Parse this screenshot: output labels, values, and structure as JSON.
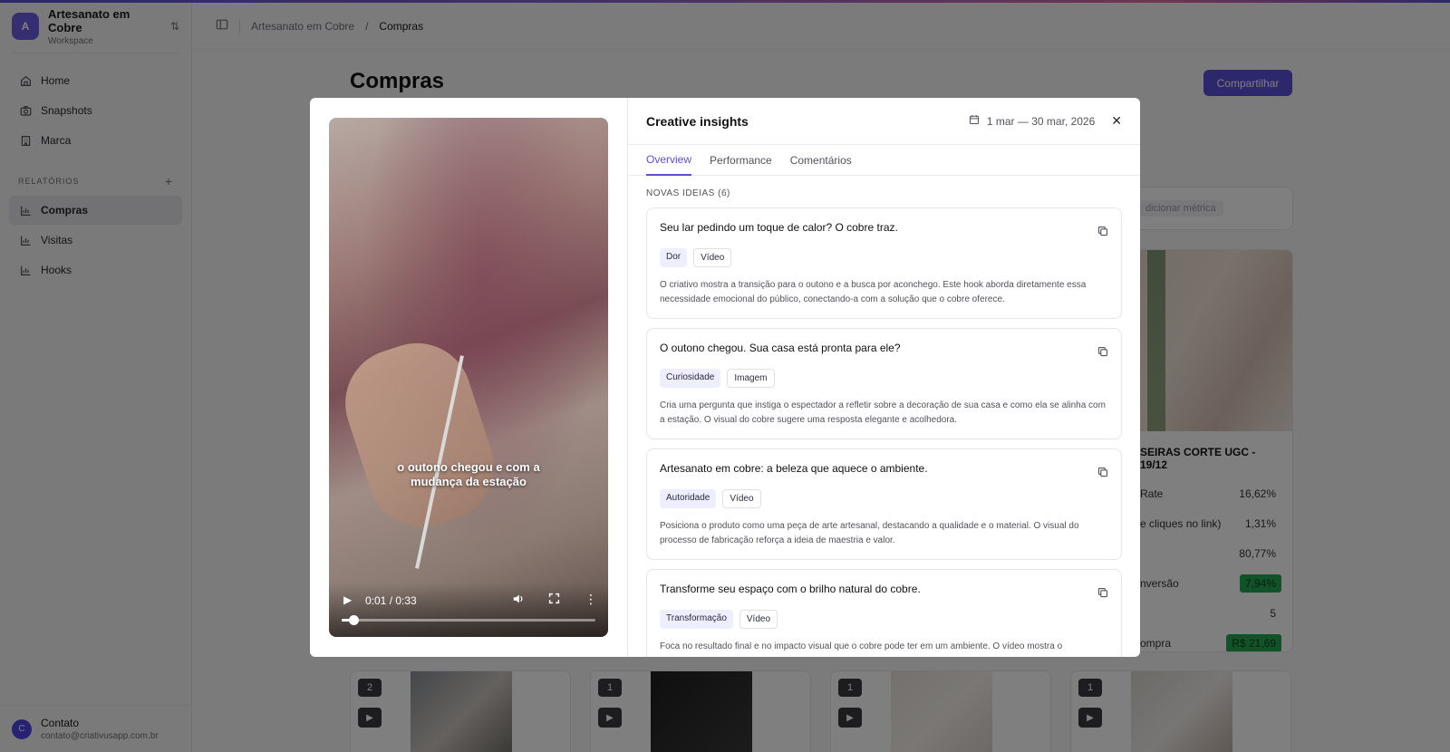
{
  "workspace": {
    "initial": "A",
    "name": "Artesanato em Cobre",
    "subtitle": "Workspace"
  },
  "nav": {
    "items": [
      {
        "label": "Home"
      },
      {
        "label": "Snapshots"
      },
      {
        "label": "Marca"
      }
    ]
  },
  "reports": {
    "section_label": "RELATÓRIOS",
    "items": [
      {
        "label": "Compras",
        "active": true
      },
      {
        "label": "Visitas"
      },
      {
        "label": "Hooks"
      }
    ]
  },
  "user": {
    "initial": "C",
    "name": "Contato",
    "email": "contato@criativusapp.com.br"
  },
  "breadcrumb": {
    "parent": "Artesanato em Cobre",
    "separator": "/",
    "current": "Compras"
  },
  "page": {
    "title": "Compras",
    "share_label": "Compartilhar",
    "add_metric": "dicionar métrica"
  },
  "background_card": {
    "title": "SEIRAS CORTE UGC - 19/12",
    "rows": [
      {
        "label": "Rate",
        "value": "16,62%"
      },
      {
        "label": "e cliques no link)",
        "value": "1,31%"
      },
      {
        "label": "",
        "value": "80,77%"
      },
      {
        "label": "nversão",
        "value": "7,94%",
        "highlight": true
      },
      {
        "label": "",
        "value": "5"
      },
      {
        "label": "ompra",
        "value": "R$ 21,69",
        "highlight": true
      }
    ]
  },
  "thumbnails": [
    {
      "count": "2"
    },
    {
      "count": "1"
    },
    {
      "count": "1"
    },
    {
      "count": "1"
    }
  ],
  "modal": {
    "title": "Creative insights",
    "date_range": "1 mar — 30 mar, 2026",
    "tabs": [
      {
        "label": "Overview",
        "active": true
      },
      {
        "label": "Performance"
      },
      {
        "label": "Comentários"
      }
    ],
    "section_label": "NOVAS IDEIAS (6)",
    "video": {
      "caption": "o outono chegou e com a mudança da estação",
      "time": "0:01 / 0:33",
      "progress": 0.045
    },
    "ideas": [
      {
        "title": "Seu lar pedindo um toque de calor? O cobre traz.",
        "tag_primary": "Dor",
        "tag_secondary": "Vídeo",
        "description": "O criativo mostra a transição para o outono e a busca por aconchego. Este hook aborda diretamente essa necessidade emocional do público, conectando-a com a solução que o cobre oferece."
      },
      {
        "title": "O outono chegou. Sua casa está pronta para ele?",
        "tag_primary": "Curiosidade",
        "tag_secondary": "Imagem",
        "description": "Cria uma pergunta que instiga o espectador a refletir sobre a decoração de sua casa e como ela se alinha com a estação. O visual do cobre sugere uma resposta elegante e acolhedora."
      },
      {
        "title": "Artesanato em cobre: a beleza que aquece o ambiente.",
        "tag_primary": "Autoridade",
        "tag_secondary": "Vídeo",
        "description": "Posiciona o produto como uma peça de arte artesanal, destacando a qualidade e o material. O visual do processo de fabricação reforça a ideia de maestria e valor."
      },
      {
        "title": "Transforme seu espaço com o brilho natural do cobre.",
        "tag_primary": "Transformação",
        "tag_secondary": "Vídeo",
        "description": "Foca no resultado final e no impacto visual que o cobre pode ter em um ambiente. O vídeo mostra o"
      }
    ]
  }
}
